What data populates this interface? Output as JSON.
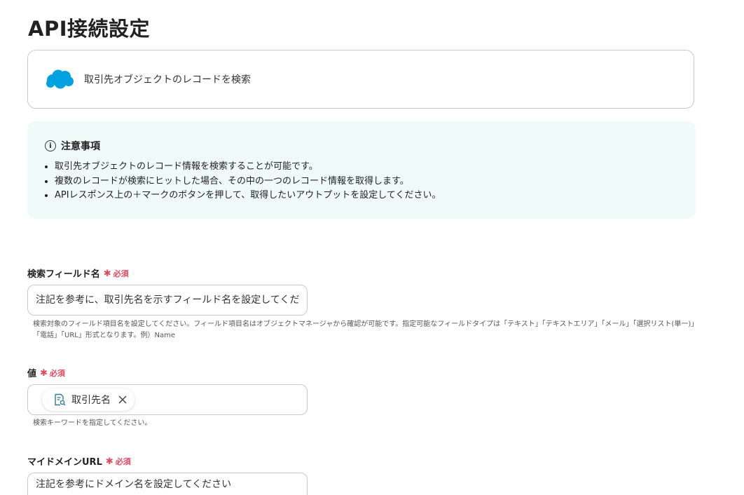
{
  "page": {
    "title": "API接続設定"
  },
  "app_card": {
    "action": "取引先オブジェクトのレコードを検索"
  },
  "notice": {
    "heading": "注意事項",
    "items": [
      "取引先オブジェクトのレコード情報を検索することが可能です。",
      "複数のレコードが検索にヒットした場合、その中の一つのレコード情報を取得します。",
      "APIレスポンス上の＋マークのボタンを押して、取得したいアウトプットを設定してください。"
    ]
  },
  "required_label": "必須",
  "fields": {
    "search_field": {
      "label": "検索フィールド名",
      "placeholder": "注記を参考に、取引先名を示すフィールド名を設定してください",
      "help": "検索対象のフィールド項目名を設定してください。フィールド項目名はオブジェクトマネージャから確認が可能です。指定可能なフィールドタイプは「テキスト」「テキストエリア」「メール」「選択リスト(単一)」「電話」「URL」形式となります。例）Name"
    },
    "value": {
      "label": "値",
      "chip": "取引先名",
      "help": "検索キーワードを指定してください。"
    },
    "domain_url": {
      "label": "マイドメインURL",
      "placeholder": "注記を参考にドメイン名を設定してください"
    }
  },
  "colors": {
    "required": "#e0485e",
    "salesforce_blue": "#00a1e0",
    "notice_bg": "#f0faf9"
  }
}
